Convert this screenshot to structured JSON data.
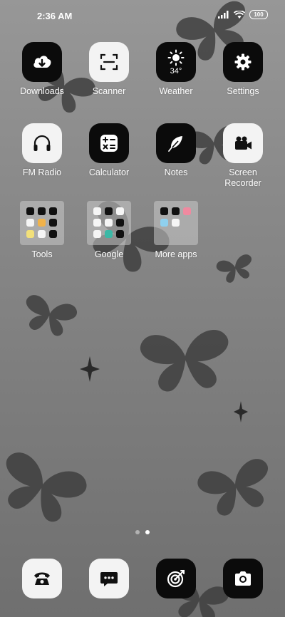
{
  "status_bar": {
    "time": "2:36 AM",
    "battery": "100"
  },
  "apps": {
    "downloads": "Downloads",
    "scanner": "Scanner",
    "weather": "Weather",
    "weather_temp": "34°",
    "settings": "Settings",
    "fm_radio": "FM Radio",
    "calculator": "Calculator",
    "notes": "Notes",
    "screen_recorder": "Screen Recorder"
  },
  "folders": {
    "tools": "Tools",
    "google": "Google",
    "more_apps": "More apps"
  },
  "page_indicator": {
    "pages": 2,
    "active": 2
  },
  "dock": [
    "phone-icon",
    "messages-icon",
    "browser-icon",
    "camera-icon"
  ],
  "colors": {
    "icon_dark": "#0b0b0b",
    "icon_light": "#f3f3f3"
  }
}
